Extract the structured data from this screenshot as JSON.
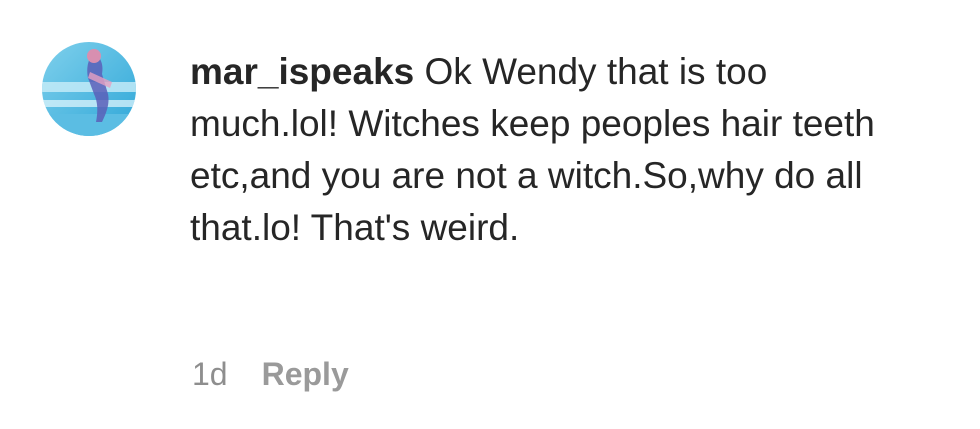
{
  "comment": {
    "username": "mar_ispeaks",
    "text": "Ok Wendy that is too much.lol! Witches keep peoples hair teeth etc,and you are not a witch.So,why do all that.lo! That's weird.",
    "timestamp": "1d",
    "reply_label": "Reply",
    "avatar_icon": "user-avatar-photo"
  }
}
